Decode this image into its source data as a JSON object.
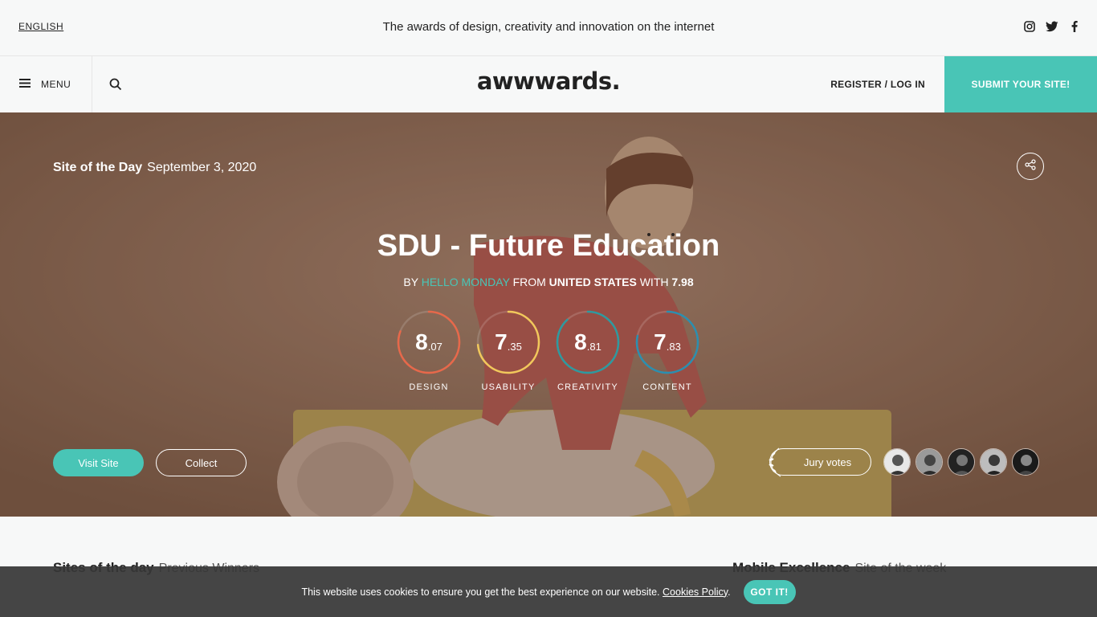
{
  "topbar": {
    "language": "ENGLISH",
    "tagline": "The awards of design, creativity and innovation on the internet",
    "social_icons": [
      "instagram-icon",
      "twitter-icon",
      "facebook-icon"
    ]
  },
  "nav": {
    "menu_label": "MENU",
    "logo": "awwwards.",
    "auth_label": "REGISTER / LOG IN",
    "submit_label": "SUBMIT YOUR SITE!"
  },
  "hero": {
    "award_label": "Site of the Day",
    "award_date": "September 3, 2020",
    "title": "SDU - Future Education",
    "by_prefix": "BY",
    "author": "HELLO MONDAY",
    "from_word": "FROM",
    "country": "UNITED STATES",
    "with_word": "WITH",
    "overall": "7.98",
    "scores": [
      {
        "label": "DESIGN",
        "int": "8",
        "dec": ".07",
        "color": "#e8684a",
        "value": 8.07
      },
      {
        "label": "USABILITY",
        "int": "7",
        "dec": ".35",
        "color": "#f2c85b",
        "value": 7.35
      },
      {
        "label": "CREATIVITY",
        "int": "8",
        "dec": ".81",
        "color": "#2d9aa0",
        "value": 8.81
      },
      {
        "label": "CONTENT",
        "int": "7",
        "dec": ".83",
        "color": "#2a8fb0",
        "value": 7.83
      }
    ],
    "visit_label": "Visit Site",
    "collect_label": "Collect",
    "jury_label": "Jury votes"
  },
  "sections": {
    "left_title": "Sites of the day",
    "left_sub": "Previous Winners",
    "right_title": "Mobile Excellence",
    "right_sub": "Site of the week"
  },
  "cookie": {
    "text": "This website uses cookies to ensure you get the best experience on our website.",
    "link": "Cookies Policy",
    "period": ".",
    "button": "GOT IT!"
  },
  "colors": {
    "accent": "#49c5b6"
  }
}
